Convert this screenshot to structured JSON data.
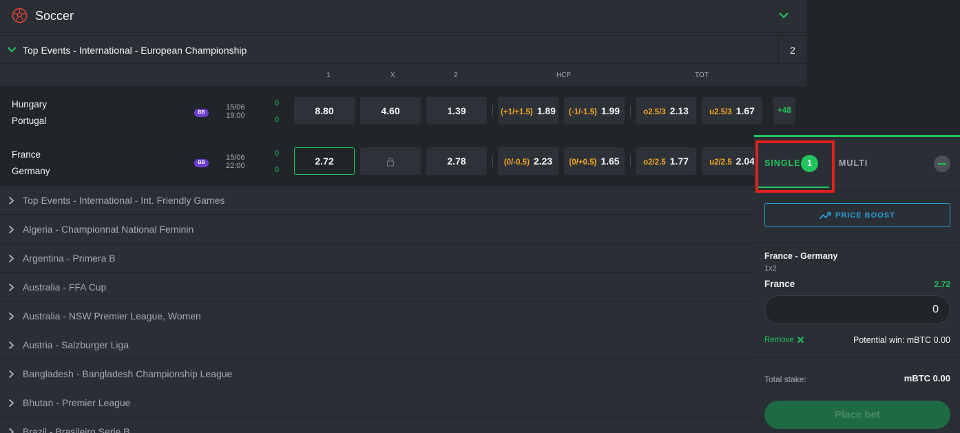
{
  "sport": {
    "title": "Soccer"
  },
  "open_league": {
    "name": "Top Events - International - European Championship",
    "count": "2"
  },
  "columns": {
    "c1": "1",
    "cx": "X",
    "c2": "2",
    "hcp": "HCP",
    "tot": "TOT"
  },
  "matches": [
    {
      "home": "Hungary",
      "away": "Portugal",
      "badge": "BB",
      "date": "15/06",
      "time": "19:00",
      "score_home": "0",
      "score_away": "0",
      "odd1": "8.80",
      "oddx": "4.60",
      "odd2": "1.39",
      "hcp1_line": "(+1/+1.5)",
      "hcp1_odd": "1.89",
      "hcp2_line": "(-1/-1.5)",
      "hcp2_odd": "1.99",
      "over_line": "o2.5/3",
      "over_odd": "2.13",
      "under_line": "u2.5/3",
      "under_odd": "1.67",
      "more": "+48"
    },
    {
      "home": "France",
      "away": "Germany",
      "badge": "BB",
      "date": "15/06",
      "time": "22:00",
      "score_home": "0",
      "score_away": "0",
      "odd1": "2.72",
      "oddx": "",
      "odd2": "2.78",
      "hcp1_line": "(0/-0.5)",
      "hcp1_odd": "2.23",
      "hcp2_line": "(0/+0.5)",
      "hcp2_odd": "1.65",
      "over_line": "o2/2.5",
      "over_odd": "1.77",
      "under_line": "u2/2.5",
      "under_odd": "2.04"
    }
  ],
  "collapsed_leagues": [
    "Top Events - International - Int. Friendly Games",
    "Algeria - Championnat National Feminin",
    "Argentina - Primera B",
    "Australia - FFA Cup",
    "Australia - NSW Premier League, Women",
    "Austria - Salzburger Liga",
    "Bangladesh - Bangladesh Championship League",
    "Bhutan - Premier League",
    "Brazil - Brasileiro Serie B"
  ],
  "betslip": {
    "tab_single": "SINGLE",
    "single_count": "1",
    "tab_multi": "MULTI",
    "price_boost": "PRICE BOOST",
    "match": "France - Germany",
    "market": "1x2",
    "selection": "France",
    "odds": "2.72",
    "stake_value": "0",
    "remove": "Remove",
    "potential_win": "Potential win: mBTC 0.00",
    "total_stake_label": "Total stake:",
    "total_stake_value": "mBTC  0.00",
    "place_bet": "Place bet"
  },
  "colors": {
    "accent": "#21c55d",
    "handicap": "#f5a623",
    "boost": "#2a9fd6",
    "highlight": "#e02020"
  }
}
